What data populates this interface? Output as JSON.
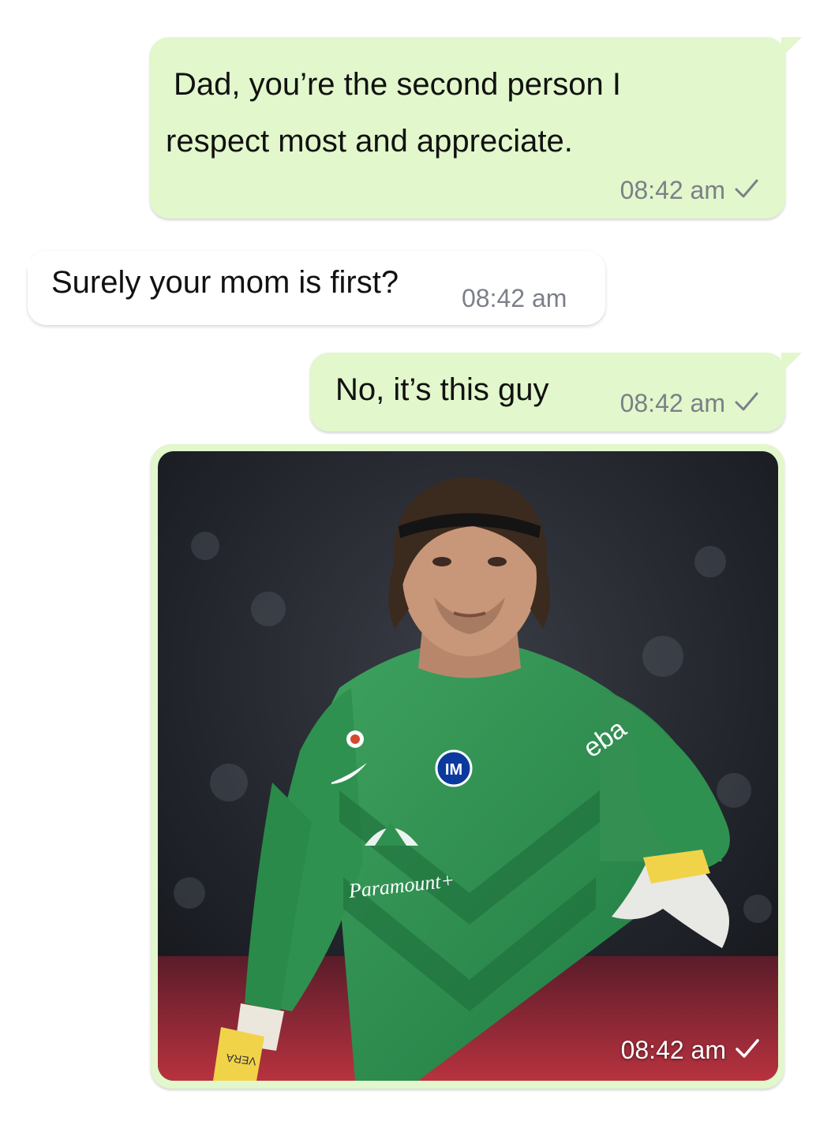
{
  "messages": [
    {
      "direction": "outgoing",
      "lines": [
        "Dad, you’re the second person I",
        "respect most and appreciate."
      ],
      "time": "08:42 am",
      "status": "sent-check-icon"
    },
    {
      "direction": "incoming",
      "text": "Surely your mom is first?",
      "time": "08:42 am"
    },
    {
      "direction": "outgoing",
      "text": "No, it’s this guy",
      "time": "08:42 am",
      "status": "sent-check-icon"
    },
    {
      "direction": "outgoing",
      "type": "photo",
      "photo": {
        "subject": "goalkeeper-photo",
        "jersey_sponsor": "Paramount+",
        "sleeve_sponsor": "eba",
        "wristband_text": "VERA"
      },
      "time": "08:42 am",
      "status": "sent-check-icon"
    }
  ],
  "colors": {
    "outgoing_bubble": "#e2f7cb",
    "incoming_bubble": "#ffffff",
    "meta_text": "#7b8088",
    "jersey_green": "#2e8f4e"
  }
}
